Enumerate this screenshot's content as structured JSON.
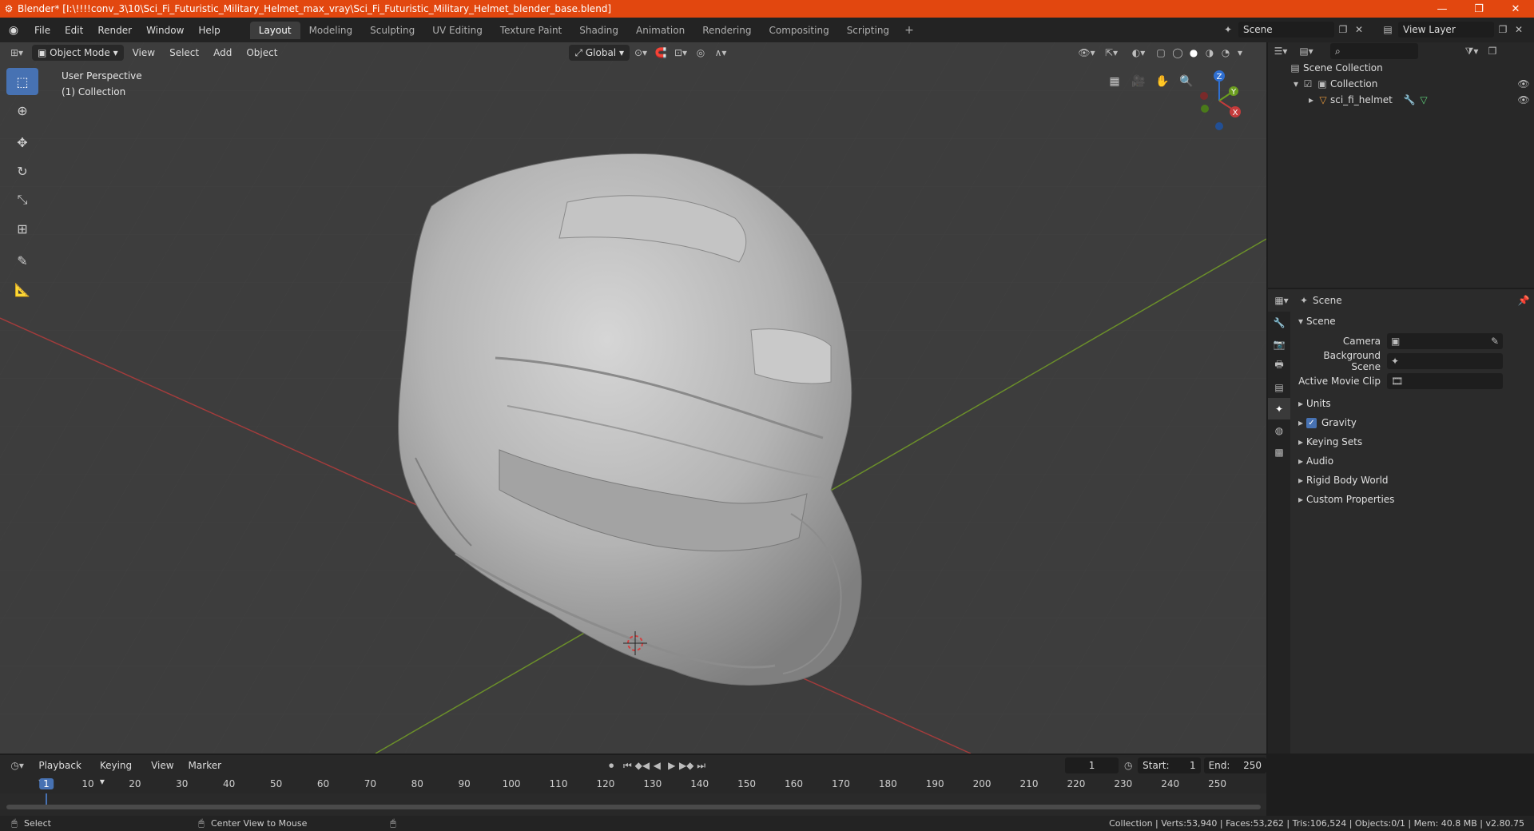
{
  "window": {
    "title": "Blender* [I:\\!!!!conv_3\\10\\Sci_Fi_Futuristic_Military_Helmet_max_vray\\Sci_Fi_Futuristic_Military_Helmet_blender_base.blend]",
    "minimize": "—",
    "maximize": "❐",
    "close": "✕"
  },
  "menu": {
    "items": [
      "File",
      "Edit",
      "Render",
      "Window",
      "Help"
    ],
    "workspaces": [
      "Layout",
      "Modeling",
      "Sculpting",
      "UV Editing",
      "Texture Paint",
      "Shading",
      "Animation",
      "Rendering",
      "Compositing",
      "Scripting"
    ],
    "active_workspace": "Layout",
    "add": "+",
    "scene": "Scene",
    "view_layer": "View Layer"
  },
  "viewport": {
    "mode": "Object Mode",
    "menus": [
      "View",
      "Select",
      "Add",
      "Object"
    ],
    "transform_orientation": "Global",
    "info_line1": "User Perspective",
    "info_line2": "(1) Collection",
    "gizmo": {
      "z": "Z",
      "y": "Y",
      "x": "X"
    }
  },
  "outliner": {
    "search_placeholder": "",
    "root": "Scene Collection",
    "collection": "Collection",
    "object": "sci_fi_helmet"
  },
  "properties": {
    "context": "Scene",
    "section": "Scene",
    "camera_label": "Camera",
    "background_scene_label": "Background Scene",
    "active_movie_clip_label": "Active Movie Clip",
    "panels": [
      "Units",
      "Gravity",
      "Keying Sets",
      "Audio",
      "Rigid Body World",
      "Custom Properties"
    ],
    "gravity_checked": true
  },
  "timeline": {
    "menus": [
      "Playback",
      "Keying",
      "View",
      "Marker"
    ],
    "current_frame": "1",
    "start_label": "Start:",
    "start": "1",
    "end_label": "End:",
    "end": "250",
    "ticks": [
      "1",
      "10",
      "20",
      "30",
      "40",
      "50",
      "60",
      "70",
      "80",
      "90",
      "100",
      "110",
      "120",
      "130",
      "140",
      "150",
      "160",
      "170",
      "180",
      "190",
      "200",
      "210",
      "220",
      "230",
      "240",
      "250"
    ]
  },
  "status": {
    "select": "Select",
    "center_view": "Center View to Mouse",
    "stats": "Collection | Verts:53,940 | Faces:53,262 | Tris:106,524 | Objects:0/1 | Mem: 40.8 MB | v2.80.75"
  },
  "colors": {
    "titlebar": "#e2470f",
    "accent": "#4772b3",
    "x_axis": "#c53b3b",
    "y_axis": "#6b9d1f",
    "z_axis": "#2f6fd1"
  }
}
